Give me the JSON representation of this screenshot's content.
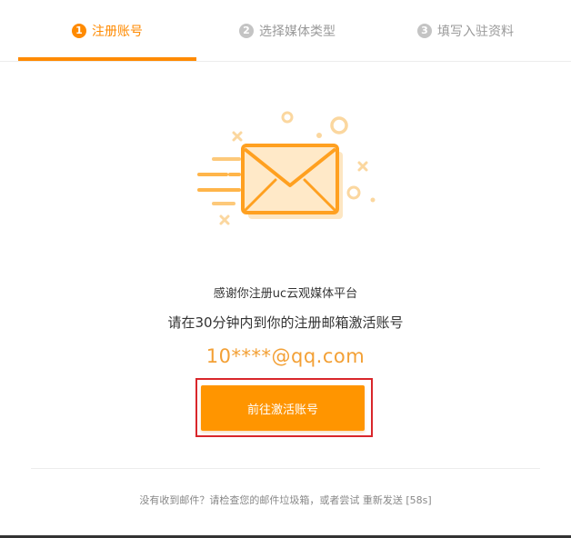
{
  "colors": {
    "accent": "#ff8a00",
    "email": "#f3a035",
    "highlight_border": "#d9262b",
    "inactive_step": "#c4c4c4"
  },
  "steps": [
    {
      "number": "1",
      "label": "注册账号",
      "active": true
    },
    {
      "number": "2",
      "label": "选择媒体类型",
      "active": false
    },
    {
      "number": "3",
      "label": "填写入驻资料",
      "active": false
    }
  ],
  "illustration": {
    "icon": "envelope-icon"
  },
  "main": {
    "thanks": "感谢你注册uc云观媒体平台",
    "instruction": "请在30分钟内到你的注册邮箱激活账号",
    "email": "10****@qq.com",
    "activate_label": "前往激活账号"
  },
  "footer": {
    "prefix": "没有收到邮件？请检查您的邮件垃圾箱，或者尝试 ",
    "resend_label": "重新发送",
    "countdown": "[58s]"
  }
}
